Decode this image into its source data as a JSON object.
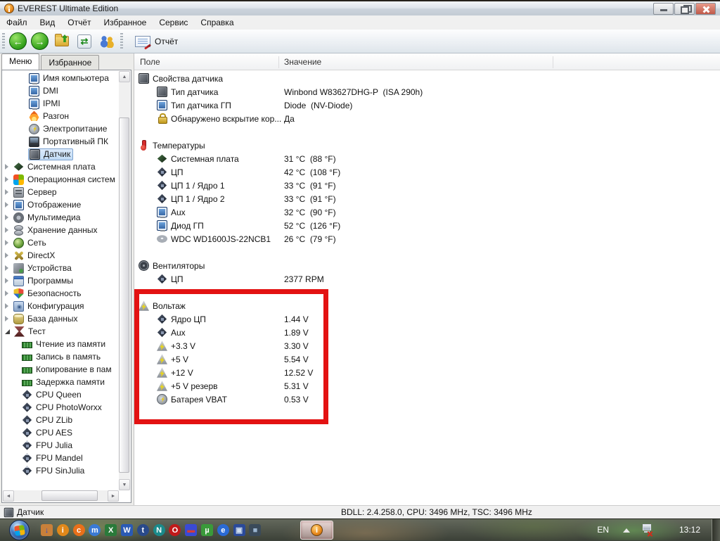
{
  "window": {
    "title": "EVEREST Ultimate Edition",
    "menu": [
      "Файл",
      "Вид",
      "Отчёт",
      "Избранное",
      "Сервис",
      "Справка"
    ],
    "toolbar": {
      "back_glyph": "←",
      "forward_glyph": "→",
      "refresh_glyph": "⇄",
      "report_label": "Отчёт"
    },
    "sidebar": {
      "tabs": [
        {
          "label": "Меню",
          "active": true
        },
        {
          "label": "Избранное",
          "active": false
        }
      ],
      "tree": [
        {
          "label": "Имя компьютера",
          "icon": "computer",
          "depth": 3
        },
        {
          "label": "DMI",
          "icon": "computer",
          "depth": 3
        },
        {
          "label": "IPMI",
          "icon": "computer",
          "depth": 3
        },
        {
          "label": "Разгон",
          "icon": "flame",
          "depth": 3
        },
        {
          "label": "Электропитание",
          "icon": "power",
          "depth": 3
        },
        {
          "label": "Портативный ПК",
          "icon": "laptop",
          "depth": 3
        },
        {
          "label": "Датчик",
          "icon": "chip",
          "depth": 3,
          "selected": true
        },
        {
          "label": "Системная плата",
          "icon": "motherboard",
          "depth": 1,
          "arrow": "collapsed"
        },
        {
          "label": "Операционная систем",
          "icon": "windows",
          "depth": 1,
          "arrow": "collapsed"
        },
        {
          "label": "Сервер",
          "icon": "server",
          "depth": 1,
          "arrow": "collapsed"
        },
        {
          "label": "Отображение",
          "icon": "display",
          "depth": 1,
          "arrow": "collapsed"
        },
        {
          "label": "Мультимедиа",
          "icon": "multimedia",
          "depth": 1,
          "arrow": "collapsed"
        },
        {
          "label": "Хранение данных",
          "icon": "storage",
          "depth": 1,
          "arrow": "collapsed"
        },
        {
          "label": "Сеть",
          "icon": "network",
          "depth": 1,
          "arrow": "collapsed"
        },
        {
          "label": "DirectX",
          "icon": "directx",
          "depth": 1,
          "arrow": "collapsed"
        },
        {
          "label": "Устройства",
          "icon": "devices",
          "depth": 1,
          "arrow": "collapsed"
        },
        {
          "label": "Программы",
          "icon": "programs",
          "depth": 1,
          "arrow": "collapsed"
        },
        {
          "label": "Безопасность",
          "icon": "security",
          "depth": 1,
          "arrow": "collapsed"
        },
        {
          "label": "Конфигурация",
          "icon": "config",
          "depth": 1,
          "arrow": "collapsed"
        },
        {
          "label": "База данных",
          "icon": "database",
          "depth": 1,
          "arrow": "collapsed"
        },
        {
          "label": "Тест",
          "icon": "test",
          "depth": 1,
          "arrow": "expanded"
        },
        {
          "label": "Чтение из памяти",
          "icon": "ram",
          "depth": 2
        },
        {
          "label": "Запись в память",
          "icon": "ram",
          "depth": 2
        },
        {
          "label": "Копирование в пам",
          "icon": "ram",
          "depth": 2
        },
        {
          "label": "Задержка памяти",
          "icon": "ram",
          "depth": 2
        },
        {
          "label": "CPU Queen",
          "icon": "cpu",
          "depth": 2
        },
        {
          "label": "CPU PhotoWorxx",
          "icon": "cpu",
          "depth": 2
        },
        {
          "label": "CPU ZLib",
          "icon": "cpu",
          "depth": 2
        },
        {
          "label": "CPU AES",
          "icon": "cpu",
          "depth": 2
        },
        {
          "label": "FPU Julia",
          "icon": "fpu",
          "depth": 2
        },
        {
          "label": "FPU Mandel",
          "icon": "fpu",
          "depth": 2
        },
        {
          "label": "FPU SinJulia",
          "icon": "fpu",
          "depth": 2
        }
      ]
    },
    "main": {
      "columns": [
        "Поле",
        "Значение"
      ],
      "rows": [
        {
          "type": "section",
          "icon": "chip",
          "label": "Свойства датчика"
        },
        {
          "type": "item",
          "icon": "chip",
          "label": "Тип датчика",
          "value": "Winbond W83627DHG-P  (ISA 290h)"
        },
        {
          "type": "item",
          "icon": "display",
          "label": "Тип датчика ГП",
          "value": "Diode  (NV-Diode)"
        },
        {
          "type": "item",
          "icon": "lock",
          "label": "Обнаружено вскрытие кор...",
          "value": "Да"
        },
        {
          "type": "blank"
        },
        {
          "type": "section",
          "icon": "thermo",
          "label": "Температуры"
        },
        {
          "type": "item",
          "icon": "motherboard",
          "label": "Системная плата",
          "value": "31 °C  (88 °F)"
        },
        {
          "type": "item",
          "icon": "cpu",
          "label": "ЦП",
          "value": "42 °C  (108 °F)"
        },
        {
          "type": "item",
          "icon": "cpu",
          "label": "ЦП 1 / Ядро 1",
          "value": "33 °C  (91 °F)"
        },
        {
          "type": "item",
          "icon": "cpu",
          "label": "ЦП 1 / Ядро 2",
          "value": "33 °C  (91 °F)"
        },
        {
          "type": "item",
          "icon": "computer",
          "label": "Aux",
          "value": "32 °C  (90 °F)"
        },
        {
          "type": "item",
          "icon": "computer",
          "label": "Диод ГП",
          "value": "52 °C  (126 °F)"
        },
        {
          "type": "item",
          "icon": "disk",
          "label": "WDC WD1600JS-22NCB1",
          "value": "26 °C  (79 °F)"
        },
        {
          "type": "blank"
        },
        {
          "type": "section",
          "icon": "fan",
          "label": "Вентиляторы"
        },
        {
          "type": "item",
          "icon": "cpu",
          "label": "ЦП",
          "value": "2377 RPM"
        },
        {
          "type": "blank"
        },
        {
          "type": "section",
          "icon": "volt",
          "label": "Вольтаж"
        },
        {
          "type": "item",
          "icon": "cpu",
          "label": "Ядро ЦП",
          "value": "1.44 V"
        },
        {
          "type": "item",
          "icon": "cpu",
          "label": "Aux",
          "value": "1.89 V"
        },
        {
          "type": "item",
          "icon": "volt",
          "label": "+3.3 V",
          "value": "3.30 V"
        },
        {
          "type": "item",
          "icon": "volt",
          "label": "+5 V",
          "value": "5.54 V"
        },
        {
          "type": "item",
          "icon": "volt",
          "label": "+12 V",
          "value": "12.52 V"
        },
        {
          "type": "item",
          "icon": "volt",
          "label": "+5 V резерв",
          "value": "5.31 V"
        },
        {
          "type": "item",
          "icon": "battery",
          "label": "Батарея VBAT",
          "value": "0.53 V"
        }
      ]
    },
    "status": {
      "left": "Датчик",
      "right": "BDLL: 2.4.258.0, CPU: 3496 MHz, TSC: 3496 MHz"
    }
  },
  "highlight": {
    "color": "#e31212"
  },
  "taskbar": {
    "quick_launch": [
      {
        "name": "sync-tool-icon",
        "glyph": "↓",
        "bg": "#c8803a",
        "fg": "#2a4ad4",
        "round": false
      },
      {
        "name": "everest-icon",
        "glyph": "i",
        "bg": "#e0881a",
        "fg": "#ffffff",
        "round": true
      },
      {
        "name": "acdsee-icon",
        "glyph": "c",
        "bg": "#e8701a",
        "fg": "#ffffff",
        "round": true
      },
      {
        "name": "maxthon-icon",
        "glyph": "m",
        "bg": "#3a7ad4",
        "fg": "#ffffff",
        "round": true
      },
      {
        "name": "excel-icon",
        "glyph": "X",
        "bg": "#2a7a3a",
        "fg": "#ffffff",
        "round": false
      },
      {
        "name": "word-icon",
        "glyph": "W",
        "bg": "#2a5ab4",
        "fg": "#ffffff",
        "round": false
      },
      {
        "name": "thunderbird-icon",
        "glyph": "t",
        "bg": "#2a4a8a",
        "fg": "#ffffff",
        "round": true
      },
      {
        "name": "nero-icon",
        "glyph": "N",
        "bg": "#1a8a8a",
        "fg": "#ffffff",
        "round": true
      },
      {
        "name": "opera-icon",
        "glyph": "O",
        "bg": "#c01a1a",
        "fg": "#ffffff",
        "round": true
      },
      {
        "name": "floppy-icon",
        "glyph": "▬",
        "bg": "#3a4ad4",
        "fg": "#d43a3a",
        "round": false
      },
      {
        "name": "utorrent-icon",
        "glyph": "µ",
        "bg": "#3a9a3a",
        "fg": "#ffffff",
        "round": false
      },
      {
        "name": "ie-icon",
        "glyph": "e",
        "bg": "#2a6ad4",
        "fg": "#ffffff",
        "round": true
      },
      {
        "name": "network-places-icon",
        "glyph": "▣",
        "bg": "#2a4a9a",
        "fg": "#cddcee",
        "round": false
      },
      {
        "name": "remote-display-icon",
        "glyph": "■",
        "bg": "#3a4a5a",
        "fg": "#9ab4ce",
        "round": false
      }
    ],
    "active_task": {
      "glyph": "i"
    },
    "tray": {
      "language": "EN",
      "time": "13:12"
    }
  }
}
